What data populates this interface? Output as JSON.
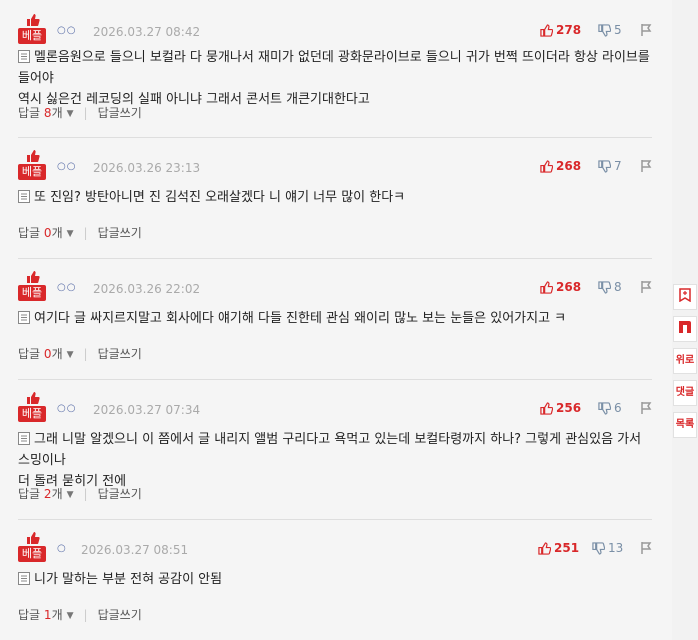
{
  "badge_label": "베플",
  "reply_label": "답글",
  "count_unit": "개",
  "write_reply_label": "답글쓰기",
  "comments": [
    {
      "nick": "○○",
      "date": "2026.03.27 08:42",
      "likes": "278",
      "dislikes": "5",
      "lines": [
        "멜론음원으로 들으니 보컬라 다 뭉개나서 재미가 없던데 광화문라이브로 들으니 귀가 번쩍 뜨이더라 항상 라이브를 들어야",
        "역시 싫은건 레코딩의 실패 아니냐 그래서 콘서트 개큰기대한다고"
      ],
      "replies": "8"
    },
    {
      "nick": "○○",
      "date": "2026.03.26 23:13",
      "likes": "268",
      "dislikes": "7",
      "lines": [
        "또 진임? 방탄아니면 진 김석진 오래살겠다 니 얘기 너무 많이 한다ㅋ"
      ],
      "replies": "0"
    },
    {
      "nick": "○○",
      "date": "2026.03.26 22:02",
      "likes": "268",
      "dislikes": "8",
      "lines": [
        "여기다 글 싸지르지말고 회사에다 얘기해 다들 진한테 관심 왜이리 많노 보는 눈들은 있어가지고 ㅋ"
      ],
      "replies": "0"
    },
    {
      "nick": "○○",
      "date": "2026.03.27 07:34",
      "likes": "256",
      "dislikes": "6",
      "lines": [
        "그래 니말 알겠으니 이 쯤에서 글 내리지 앨범 구리다고 욕먹고 있는데 보컬타령까지 하나? 그렇게 관심있음 가서 스밍이나",
        "더 돌려 묻히기 전에"
      ],
      "replies": "2"
    },
    {
      "nick": "○",
      "date": "2026.03.27 08:51",
      "likes": "251",
      "dislikes": "13",
      "lines": [
        "니가 말하는 부분 전혀 공감이 안됨"
      ],
      "replies": "1"
    }
  ],
  "side_buttons": [
    {
      "icon": "bookmark-icon",
      "label": ""
    },
    {
      "icon": "n-logo-icon",
      "label": ""
    },
    {
      "icon": "",
      "label": "위로"
    },
    {
      "icon": "",
      "label": "댓글"
    },
    {
      "icon": "",
      "label": "목록"
    }
  ],
  "colors": {
    "accent": "#d9282a",
    "background": "#f5f5f5",
    "muted": "#aaaaaa",
    "dislike": "#7a8fa6"
  }
}
